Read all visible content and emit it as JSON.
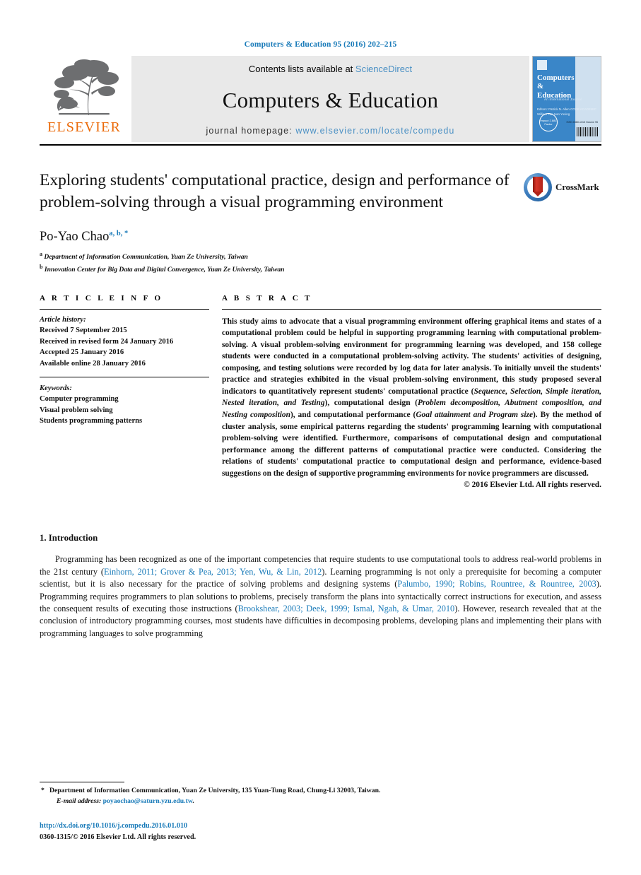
{
  "running_head": "Computers & Education 95 (2016) 202–215",
  "masthead": {
    "contents_prefix": "Contents lists available at ",
    "sciencedirect": "ScienceDirect",
    "journal_title": "Computers & Education",
    "homepage_prefix": "journal homepage: ",
    "homepage_url": "www.elsevier.com/locate/compedu",
    "publisher_wordmark": "ELSEVIER",
    "cover": {
      "title": "Computers & Education",
      "subtitle": "An International Journal",
      "editors": "Editors:\nPatrick N. Allen\nCODE ACADEMIC\nWilliam Tan\nIvan Yuxing",
      "seal": "Impact\n2.881\nFactor",
      "issn": "ISSN 0360-1315\nVolume 95"
    }
  },
  "article": {
    "title": "Exploring students' computational practice, design and performance of problem-solving through a visual programming environment",
    "crossmark_label": "CrossMark",
    "author": "Po-Yao Chao",
    "author_marks": "a, b, *",
    "affiliations": [
      {
        "mark": "a",
        "text": "Department of Information Communication, Yuan Ze University, Taiwan"
      },
      {
        "mark": "b",
        "text": "Innovation Center for Big Data and Digital Convergence, Yuan Ze University, Taiwan"
      }
    ]
  },
  "info": {
    "heading": "A R T I C L E   I N F O",
    "history_label": "Article history:",
    "history": [
      "Received 7 September 2015",
      "Received in revised form 24 January 2016",
      "Accepted 25 January 2016",
      "Available online 28 January 2016"
    ],
    "keywords_label": "Keywords:",
    "keywords": [
      "Computer programming",
      "Visual problem solving",
      "Students programming patterns"
    ]
  },
  "abstract": {
    "heading": "A B S T R A C T",
    "p1_a": "This study aims to advocate that a visual programming environment offering graphical items and states of a computational problem could be helpful in supporting programming learning with computational problem-solving. A visual problem-solving environment for programming learning was developed, and 158 college students were conducted in a computational problem-solving activity. The students' activities of designing, composing, and testing solutions were recorded by log data for later analysis. To initially unveil the students' practice and strategies exhibited in the visual problem-solving environment, this study proposed several indicators to quantitatively represent students' computational practice (",
    "terms_practice": "Sequence, Selection, Simple iteration, Nested iteration, and Testing",
    "p1_b": "), computational design (",
    "terms_design": "Problem decomposition, Abutment composition, and Nesting composition",
    "p1_c": "), and computational performance (",
    "terms_perf": "Goal attainment and Program size",
    "p1_d": "). By the method of cluster analysis, some empirical patterns regarding the students' programming learning with computational problem-solving were identified. Furthermore, comparisons of computational design and computational performance among the different patterns of computational practice were conducted. Considering the relations of students' computational practice to computational design and performance, evidence-based suggestions on the design of supportive programming environments for novice programmers are discussed.",
    "copyright": "© 2016 Elsevier Ltd. All rights reserved."
  },
  "introduction": {
    "number_title": "1. Introduction",
    "p1_s1": "Programming has been recognized as one of the important competencies that require students to use computational tools to address real-world problems in the 21st century (",
    "cite1": "Einhorn, 2011; Grover & Pea, 2013; Yen, Wu, & Lin, 2012",
    "p1_s2": "). Learning programming is not only a prerequisite for becoming a computer scientist, but it is also necessary for the practice of solving problems and designing systems (",
    "cite2": "Palumbo, 1990; Robins, Rountree, & Rountree, 2003",
    "p1_s3": "). Programming requires programmers to plan solutions to problems, precisely transform the plans into syntactically correct instructions for execution, and assess the consequent results of executing those instructions (",
    "cite3": "Brookshear, 2003; Deek, 1999; Ismal, Ngah, & Umar, 2010",
    "p1_s4": "). However, research revealed that at the conclusion of introductory programming courses, most students have difficulties in decomposing problems, developing plans and implementing their plans with programming languages to solve programming"
  },
  "footer": {
    "corr_star": "*",
    "corr_address": "Department of Information Communication, Yuan Ze University, 135 Yuan-Tung Road, Chung-Li 32003, Taiwan.",
    "email_label": "E-mail address:",
    "email": "poyaochao@saturn.yzu.edu.tw",
    "email_trail": ".",
    "doi": "http://dx.doi.org/10.1016/j.compedu.2016.01.010",
    "issn_line": "0360-1315/© 2016 Elsevier Ltd. All rights reserved."
  },
  "colors": {
    "link_blue": "#1a7bb9",
    "masthead_blue": "#4a90c4",
    "elsevier_orange": "#eb6a09",
    "masthead_gray": "#e9e9e9"
  }
}
